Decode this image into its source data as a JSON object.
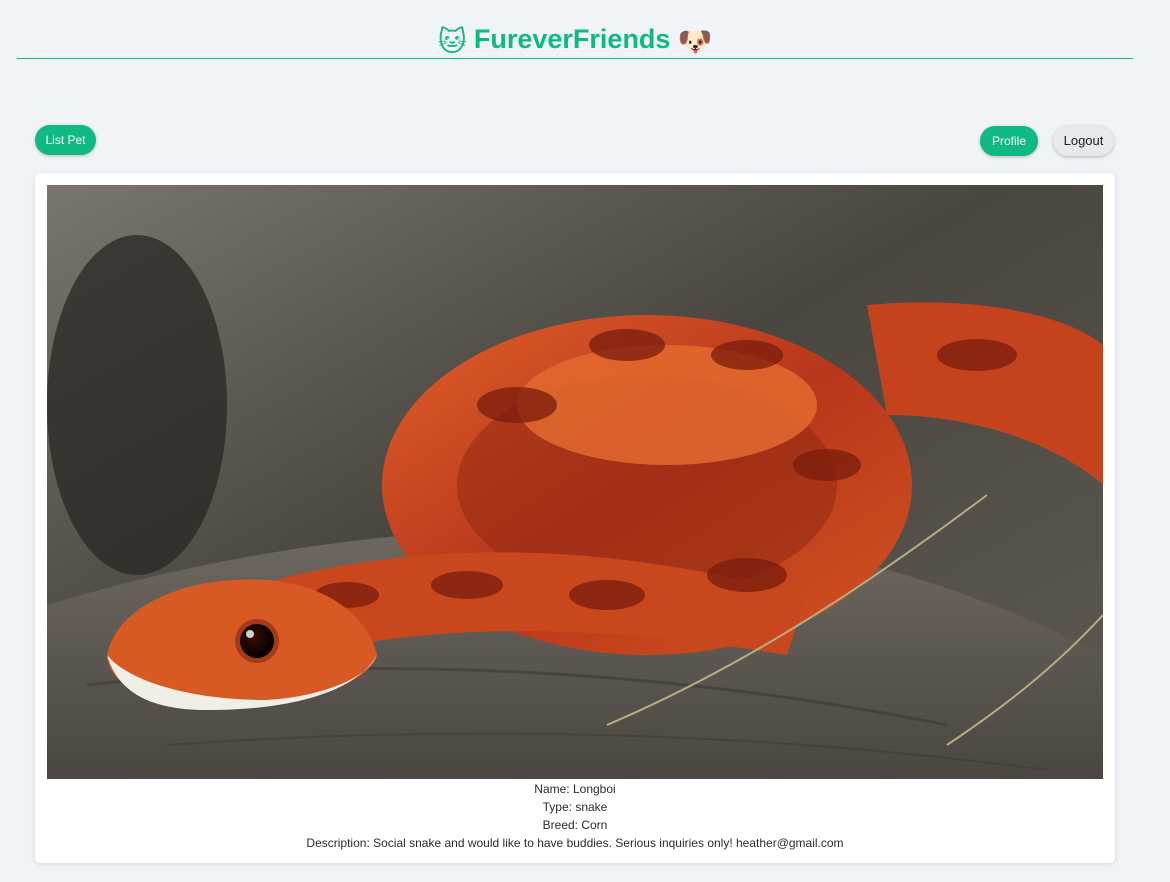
{
  "header": {
    "title": "FureverFriends",
    "left_emoji": "🐱",
    "right_emoji": "🐶",
    "accent_color": "#10b981"
  },
  "toolbar": {
    "list_pet_label": "List Pet",
    "profile_label": "Profile",
    "logout_label": "Logout"
  },
  "pet": {
    "image_subject": "corn snake coiled on a log",
    "name_line": "Name: Longboi",
    "type_line": "Type: snake",
    "breed_line": "Breed: Corn",
    "description_line": "Description: Social snake and would like to have buddies. Serious inquiries only! heather@gmail.com"
  }
}
